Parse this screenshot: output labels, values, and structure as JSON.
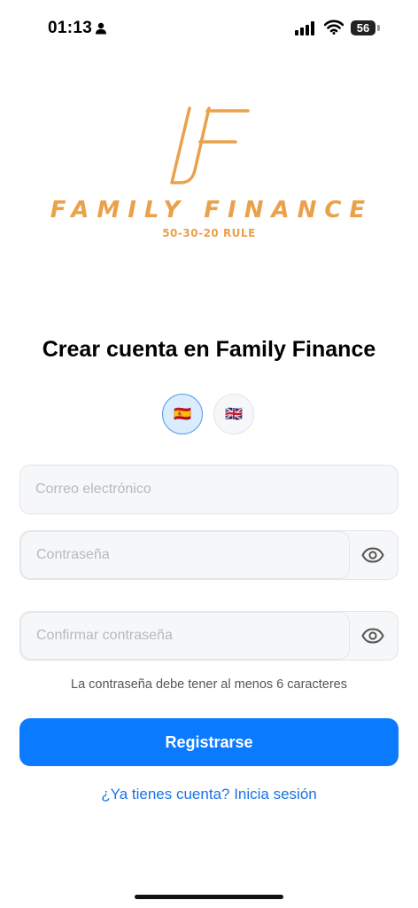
{
  "status_bar": {
    "time": "01:13",
    "battery": "56"
  },
  "logo": {
    "name": "FAMILY FINANCE",
    "tagline": "50-30-20 RULE",
    "color": "#eaa14a"
  },
  "form": {
    "title": "Crear cuenta en Family Finance",
    "languages": [
      {
        "code": "es",
        "flag": "🇪🇸",
        "selected": true
      },
      {
        "code": "en",
        "flag": "🇬🇧",
        "selected": false
      }
    ],
    "email_placeholder": "Correo electrónico",
    "password_placeholder": "Contraseña",
    "confirm_placeholder": "Confirmar contraseña",
    "password_hint": "La contraseña debe tener al menos 6 caracteres",
    "submit_label": "Registrarse",
    "login_link": "¿Ya tienes cuenta? Inicia sesión"
  },
  "colors": {
    "primary": "#0a7bff",
    "link": "#1a73e8",
    "field_bg": "#f6f7f9"
  }
}
